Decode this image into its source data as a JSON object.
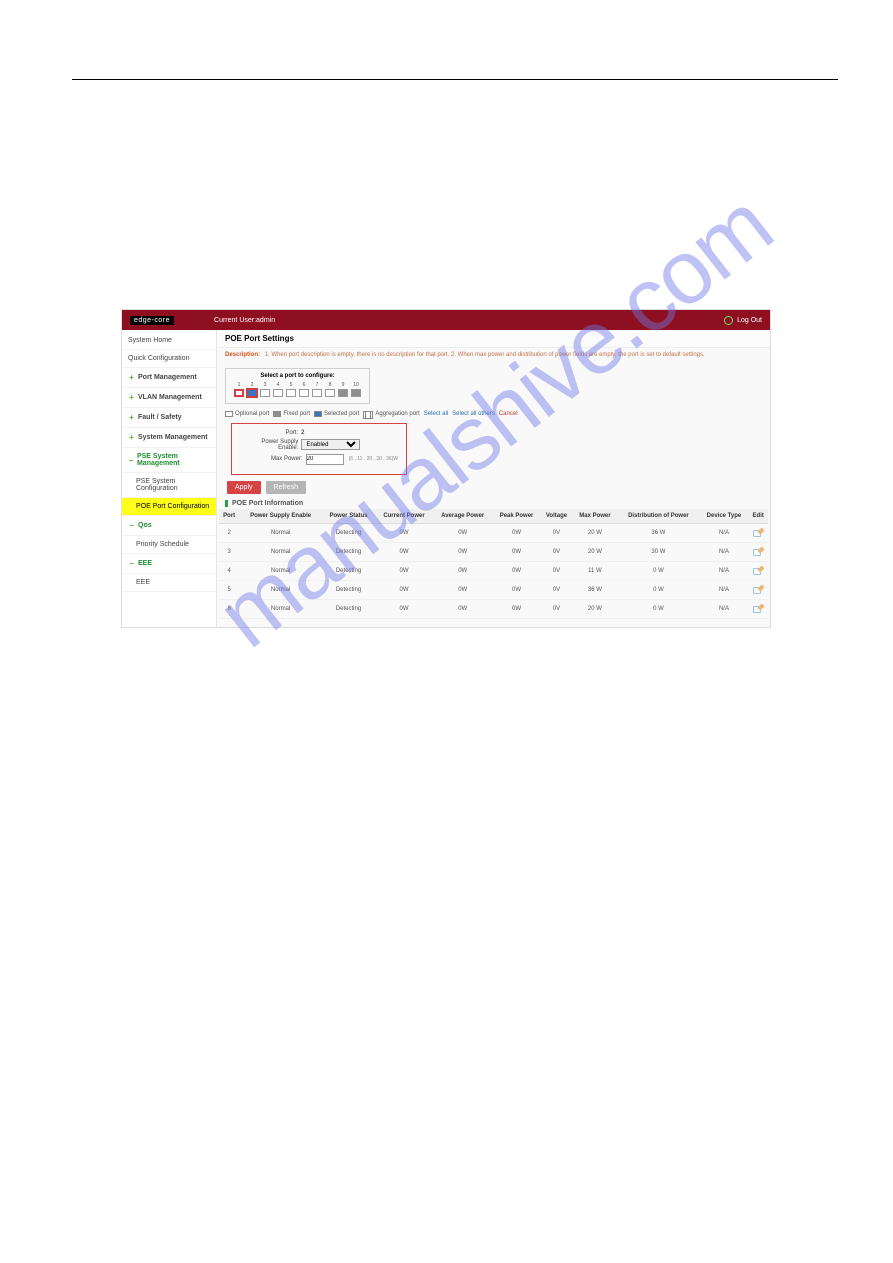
{
  "watermark": "manualshive.com",
  "header": {
    "brand": "edge-core",
    "current_user_label": "Current User:admin",
    "logout": "Log Out"
  },
  "sidebar": {
    "items": [
      {
        "label": "System Home",
        "type": "plain"
      },
      {
        "label": "Quick Configuration",
        "type": "plain"
      },
      {
        "label": "Port Management",
        "type": "plus"
      },
      {
        "label": "VLAN Management",
        "type": "plus"
      },
      {
        "label": "Fault / Safety",
        "type": "plus"
      },
      {
        "label": "System Management",
        "type": "plus"
      },
      {
        "label": "PSE System Management",
        "type": "minus-green"
      },
      {
        "label": "PSE System Configuration",
        "type": "sub"
      },
      {
        "label": "POE Port Configuration",
        "type": "sub-yellow"
      },
      {
        "label": "Qos",
        "type": "minus-green"
      },
      {
        "label": "Priority Schedule",
        "type": "sub"
      },
      {
        "label": "EEE",
        "type": "minus-green"
      },
      {
        "label": "EEE",
        "type": "sub"
      }
    ]
  },
  "content": {
    "title": "POE Port Settings",
    "description_label": "Description:",
    "description_text": "1. When port description is empty, there is no description for that port. 2. When max power and distribution of power fields are empty, the port is set to default settings.",
    "select_title": "Select a port to configure:",
    "port_count": 10,
    "selected_port_index": 2,
    "legend": {
      "optional": "Optional port",
      "fixed": "Fixed port",
      "selected": "Selected port",
      "aggregation": "Aggregation port",
      "select_all": "Select all",
      "select_others": "Select all others",
      "cancel": "Cancel"
    },
    "config": {
      "port_label": "Port:",
      "port_value": "2",
      "pse_label": "Power Supply Enable:",
      "pse_value": "Enabled",
      "maxpower_label": "Max Power:",
      "maxpower_value": "20",
      "maxpower_hint": "(6 , 11 , 20 , 30 , 36)W"
    },
    "buttons": {
      "apply": "Apply",
      "refresh": "Refresh"
    },
    "info_title": "POE Port Information",
    "table": {
      "headers": [
        "Port",
        "Power Supply Enable",
        "Power Status",
        "Current Power",
        "Average Power",
        "Peak Power",
        "Voltage",
        "Max Power",
        "Distribution of Power",
        "Device Type",
        "Edit"
      ],
      "rows": [
        {
          "port": "2",
          "pse": "Normal",
          "status": "Detecting",
          "cur": "0W",
          "avg": "0W",
          "peak": "0W",
          "volt": "0V",
          "max": "20 W",
          "dist": "36 W",
          "dev": "N/A"
        },
        {
          "port": "3",
          "pse": "Normal",
          "status": "Detecting",
          "cur": "0W",
          "avg": "0W",
          "peak": "0W",
          "volt": "0V",
          "max": "20 W",
          "dist": "30 W",
          "dev": "N/A"
        },
        {
          "port": "4",
          "pse": "Normal",
          "status": "Detecting",
          "cur": "0W",
          "avg": "0W",
          "peak": "0W",
          "volt": "0V",
          "max": "11 W",
          "dist": "0 W",
          "dev": "N/A"
        },
        {
          "port": "5",
          "pse": "Normal",
          "status": "Detecting",
          "cur": "0W",
          "avg": "0W",
          "peak": "0W",
          "volt": "0V",
          "max": "36 W",
          "dist": "0 W",
          "dev": "N/A"
        },
        {
          "port": "8",
          "pse": "Normal",
          "status": "Detecting",
          "cur": "0W",
          "avg": "0W",
          "peak": "0W",
          "volt": "0V",
          "max": "20 W",
          "dist": "0 W",
          "dev": "N/A"
        }
      ]
    }
  }
}
